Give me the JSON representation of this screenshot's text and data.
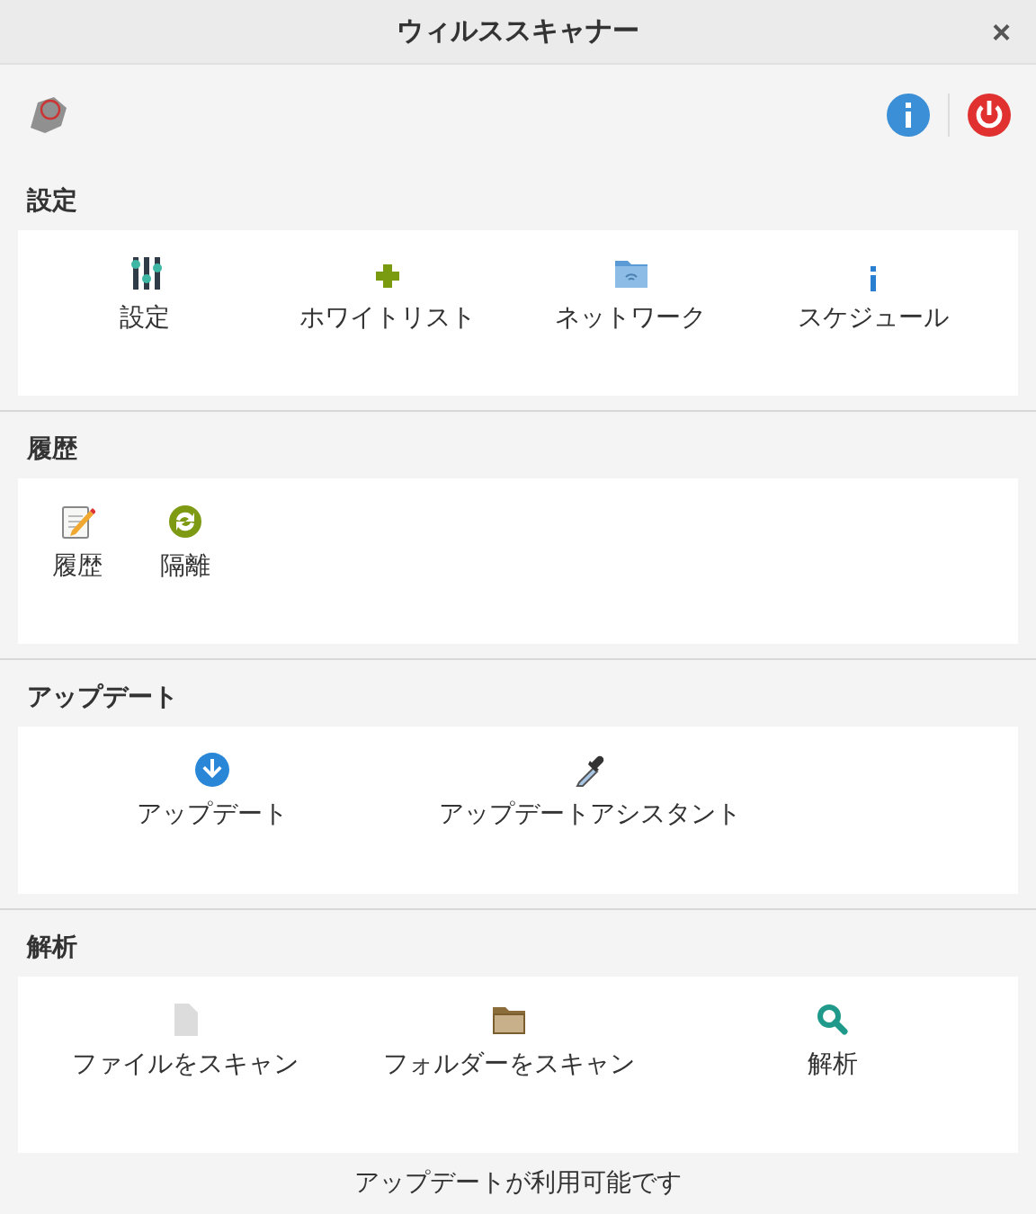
{
  "window": {
    "title": "ウィルススキャナー",
    "close": "×"
  },
  "sections": [
    {
      "title": "設定",
      "kind": "grid",
      "items": [
        "設定",
        "ホワイトリスト",
        "ネットワーク",
        "スケジュール"
      ]
    },
    {
      "title": "履歴",
      "kind": "compact",
      "items": [
        "履歴",
        "隔離"
      ]
    },
    {
      "title": "アップデート",
      "kind": "grid",
      "items": [
        "アップデート",
        "アップデートアシスタント"
      ]
    },
    {
      "title": "解析",
      "kind": "grid",
      "items": [
        "ファイルをスキャン",
        "フォルダーをスキャン",
        "解析"
      ]
    }
  ],
  "status": "アップデートが利用可能です"
}
